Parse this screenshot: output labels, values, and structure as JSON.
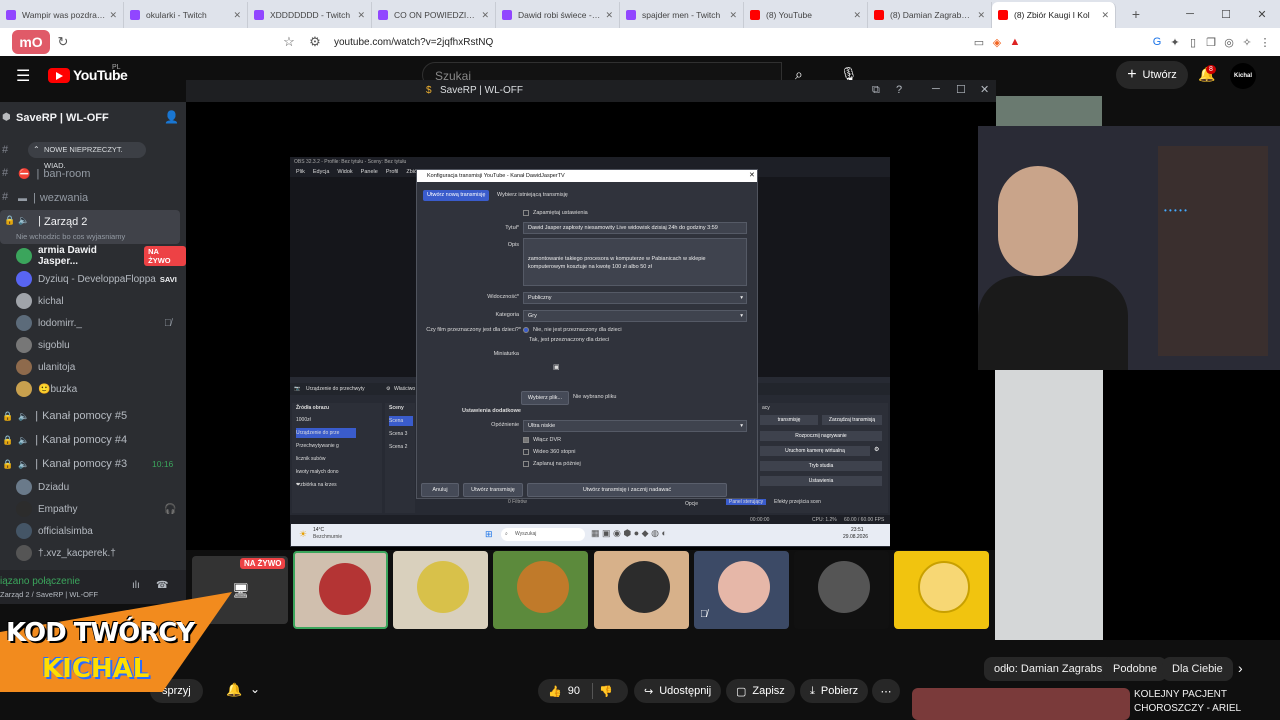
{
  "browser": {
    "tabs": [
      {
        "label": "Wampir was pozdrawia -",
        "color": "#9146ff"
      },
      {
        "label": "okularki - Twitch",
        "color": "#9146ff"
      },
      {
        "label": "XDDDDDDD - Twitch",
        "color": "#9146ff"
      },
      {
        "label": "CO ON POWIEDZIAŁ XDD",
        "color": "#9146ff"
      },
      {
        "label": "Dawid robi świece - Twit",
        "color": "#9146ff"
      },
      {
        "label": "spajder men - Twitch",
        "color": "#9146ff"
      },
      {
        "label": "(8) YouTube",
        "color": "#ff0000"
      },
      {
        "label": "(8) Damian Zagrabski - Yo",
        "color": "#ff0000"
      },
      {
        "label": "(8) Zbiór Kaugi I Kol",
        "color": "#ff0000"
      }
    ],
    "url": "youtube.com/watch?v=2jqfhxRstNQ"
  },
  "youtube": {
    "logo_text": "YouTube",
    "region": "PL",
    "search_placeholder": "Szukaj",
    "create_label": "Utwórz",
    "notif_count": "8",
    "avatar_label": "Kichal",
    "chips": [
      "odło: Damian Zagrabski",
      "Podobne",
      "Dla Ciebie"
    ],
    "actions": {
      "likes": "90",
      "share": "Udostępnij",
      "save": "Zapisz",
      "download": "Pobierz",
      "more": "⋯"
    },
    "subscribe_partial": "sprzyj",
    "related_title_1": "KOLEJNY PACJENT",
    "related_title_2": "CHOROSZCZY - ARIEL"
  },
  "discord": {
    "window_title": "SaveRP | WL-OFF",
    "server_name": "SaveRP | WL-OFF",
    "new_badge": "NOWE NIEPRZECZYT. WIAD.",
    "channels": [
      {
        "label": "ban-room",
        "icon": "⛔"
      },
      {
        "label": "wezwania",
        "icon": "🇵🇱"
      }
    ],
    "voice_active": "Zarząd 2",
    "voice_active_sub": "Nie wchodzic bo cos wyjasniamy",
    "voice_users_1": [
      {
        "name": "armia Dawid Jasper...",
        "badge": "NA ŻYWO"
      },
      {
        "name": "Dyziuq - DeveloppaFloppa",
        "badge": "SAVI"
      },
      {
        "name": "kichal",
        "badge": ""
      },
      {
        "name": "lodomirr._",
        "badge": ""
      },
      {
        "name": "sigoblu",
        "badge": ""
      },
      {
        "name": "ulanitoja",
        "badge": ""
      },
      {
        "name": "🙂buzka",
        "badge": ""
      }
    ],
    "help_channels": [
      "Kanał pomocy #5",
      "Kanał pomocy #4",
      "Kanał pomocy #3"
    ],
    "help3_time": "10:16",
    "voice_users_2": [
      "Dziadu",
      "Empathy",
      "officialsimba",
      "†.xvz_kacperek.†"
    ],
    "voice_status": "iązano połączenie",
    "voice_status_sub": "Zarząd 2 / SaveRP | WL-OFF",
    "live_badge": "NA ŻYWO"
  },
  "obs": {
    "window_title": "OBS 32.3.2 - Profile: Bez tytułu - Sceny: Bez tytułu",
    "menu": [
      "Plik",
      "Edycja",
      "Widok",
      "Panele",
      "Profil",
      "Zbiór sc"
    ],
    "sources_title": "Źródła obrazu",
    "sources": [
      "1000zł",
      "Urządzenie do prze",
      "Przechwytywanie g",
      "licznik subów",
      "kwoty małych dono",
      "❤zbiórka na krzes"
    ],
    "scenes_title": "Sceny",
    "scenes": [
      "Scena",
      "Scena 3",
      "Scena 2"
    ],
    "device_label": "Urządzenie do przechwyty",
    "props_label": "Właściwo",
    "controls": [
      "Rozpocznij nagrywanie",
      "Uruchom kamerę wirtualną",
      "Tryb studia",
      "Ustawienia"
    ],
    "manage_label": "Zarządzaj transmisją",
    "start_partial": "transmisję",
    "controls_title": "acy",
    "status": "CPU: 1.2%",
    "fps": "60.00 / 60.00 FPS",
    "time": "00:00:00",
    "filters_label": "0 Filtrów",
    "tab_dock1": "Panel sterujący",
    "tab_dock2": "Efekty przejścia scen",
    "options_label": "Opcje"
  },
  "dialog": {
    "title": "Konfiguracja transmisji YouTube - Kanał DawidJasperTV",
    "tab_new": "Utwórz nową transmisję",
    "tab_existing": "Wybierz istniejącą transmisję",
    "remember": "Zapamiętaj ustawienia",
    "title_label": "Tytuł*",
    "title_value": "Dawid Jasper zapłosty niesamowity Live widowisk dzisiaj 24h do godziny 3:59",
    "desc_label": "Opis",
    "desc_line1": "zamontowanie takiego procesora w komputerze w Pabianicach w sklepie",
    "desc_line2": "komputerowym kosztuje na kwotę 100 zł albo 50 zł",
    "visibility_label": "Widoczność*",
    "visibility_value": "Publiczny",
    "category_label": "Kategoria",
    "category_value": "Gry",
    "kids_label": "Czy film przeznaczony jest dla dzieci?*",
    "kids_no": "Nie, nie jest przeznaczony dla dzieci",
    "kids_yes": "Tak, jest przeznaczony dla dzieci",
    "thumb_label": "Miniaturka",
    "choose_file": "Wybierz plik...",
    "no_file": "Nie wybrano pliku",
    "extra_label": "Ustawienia dodatkowe",
    "latency_label": "Opóźnienie",
    "latency_value": "Ultra niskie",
    "dvr": "Włącz DVR",
    "video360": "Wideo 360 stopni",
    "schedule": "Zaplanuj na później",
    "cancel": "Anuluj",
    "create": "Utwórz transmisję",
    "create_start": "Utwórz transmisję i zacznij nadawać"
  },
  "taskbar": {
    "weather_temp": "14°C",
    "weather_desc": "Bezchmurnie",
    "search": "Wyszukaj",
    "clock_time": "23:51",
    "clock_date": "29.08.2026"
  },
  "promo": {
    "line1": "KOD TWÓRCY",
    "line2": "KICHAL"
  }
}
